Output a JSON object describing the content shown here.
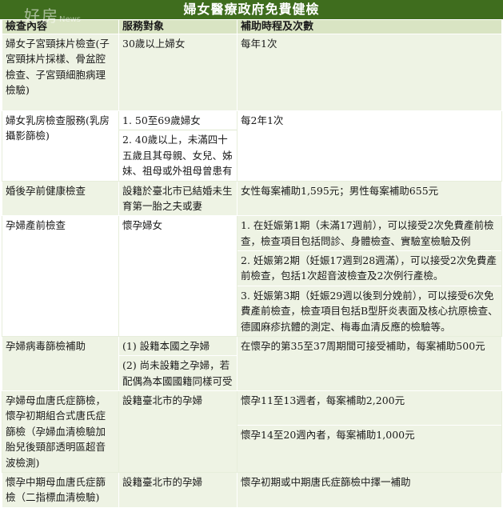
{
  "title": "婦女醫療政府免費健檢",
  "watermark": "好房",
  "watermark_sub": "News",
  "headers": [
    "檢查內容",
    "服務對象",
    "補助時程及次數"
  ],
  "rows": [
    {
      "item": "婦女子宮頸抹片檢查(子宮頸抹片採樣、骨盆腔檢查、子宮頸細胞病理檢驗)",
      "target": [
        "30歲以上婦女"
      ],
      "subsidy": [
        "每年1次"
      ]
    },
    {
      "item": "婦女乳房檢查服務(乳房攝影篩檢)",
      "target": [
        "1. 50至69歲婦女",
        "2. 40歲以上，未滿四十五歲且其母親、女兒、姊妹、祖母或外祖母曾患有"
      ],
      "subsidy": [
        "每2年1次"
      ]
    },
    {
      "item": "婚後孕前健康檢查",
      "target": [
        "設籍於臺北市已結婚未生育第一胎之夫或妻"
      ],
      "subsidy": [
        "女性每案補助1,595元；男性每案補助655元"
      ]
    },
    {
      "item": "孕婦產前檢查",
      "target": [
        "懷孕婦女"
      ],
      "subsidy": [
        "1. 在妊娠第1期（未滿17週前），可以接受2次免費產前檢查，檢查項目包括問診、身體檢查、實驗室檢驗及例",
        "2. 妊娠第2期（妊娠17週到28週滿），可以接受2次免費產前檢查，包括1次超音波檢查及2次例行產檢。",
        "3. 妊娠第3期（妊娠29週以後到分娩前），可以接受6次免費產前檢查，檢查項目包括B型肝炎表面及核心抗原檢查、德國麻疹抗體的測定、梅毒血清反應的檢驗等。"
      ]
    },
    {
      "item": "孕婦病毒篩檢補助",
      "target": [
        "(1) 設籍本國之孕婦",
        "(2) 尚未設籍之孕婦，若配偶為本國國籍同樣可受"
      ],
      "subsidy": [
        "在懷孕的第35至37周期間可接受補助，每案補助500元"
      ]
    },
    {
      "item": "孕婦母血唐氏症篩檢，懷孕初期組合式唐氏症篩檢（孕婦血清檢驗加胎兒後頸部透明區超音波檢測)",
      "target": [
        "設籍臺北市的孕婦"
      ],
      "subsidy": [
        "懷孕11至13週者，每案補助2,200元",
        "懷孕14至20週內者，每案補助1,000元"
      ]
    },
    {
      "item": "懷孕中期母血唐氏症篩檢（二指標血清檢驗)",
      "target": [
        "設籍臺北市的孕婦"
      ],
      "subsidy": [
        "懷孕初期或中期唐氏症篩檢中擇一補助"
      ]
    }
  ]
}
